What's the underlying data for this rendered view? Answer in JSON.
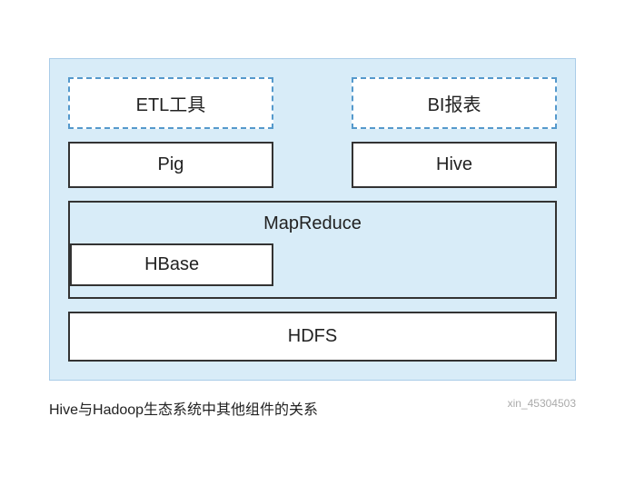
{
  "diagram": {
    "background_color": "#d8ecf8",
    "border_color": "#aacce8",
    "top_row": {
      "left_label": "ETL工具",
      "right_label": "BI报表"
    },
    "second_row": {
      "left_label": "Pig",
      "right_label": "Hive"
    },
    "mapreduce_label": "MapReduce",
    "hbase_label": "HBase",
    "hdfs_label": "HDFS"
  },
  "caption": {
    "text": "Hive与Hadoop生态系统中其他组件的关系",
    "watermark": "xin_45304503"
  }
}
